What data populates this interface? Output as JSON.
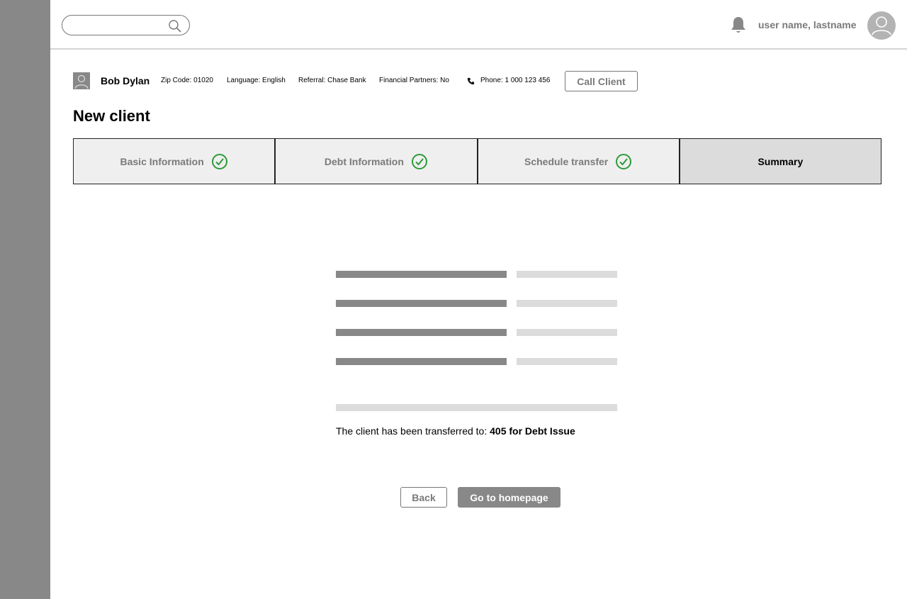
{
  "header": {
    "search": {
      "placeholder": "",
      "value": ""
    },
    "user_name": "user name, lastname"
  },
  "client": {
    "name": "Bob Dylan",
    "zip": "Zip Code: 01020",
    "language": "Language: English",
    "referral": "Referral: Chase Bank",
    "partners": "Financial Partners: No",
    "phone": "Phone: 1 000 123 456",
    "call_label": "Call Client"
  },
  "page_title": "New client",
  "steps": [
    {
      "label": "Basic Information",
      "completed": true
    },
    {
      "label": "Debt Information",
      "completed": true
    },
    {
      "label": "Schedule transfer",
      "completed": true
    },
    {
      "label": "Summary",
      "completed": false,
      "active": true
    }
  ],
  "transfer": {
    "prefix": "The client has been transferred to:",
    "target": "405 for Debt Issue"
  },
  "actions": {
    "back_label": "Back",
    "home_label": "Go to homepage"
  },
  "colors": {
    "sidebar": "#888888",
    "check": "#2e9a3a",
    "active_step": "#dcdcdc",
    "step": "#efefef"
  }
}
